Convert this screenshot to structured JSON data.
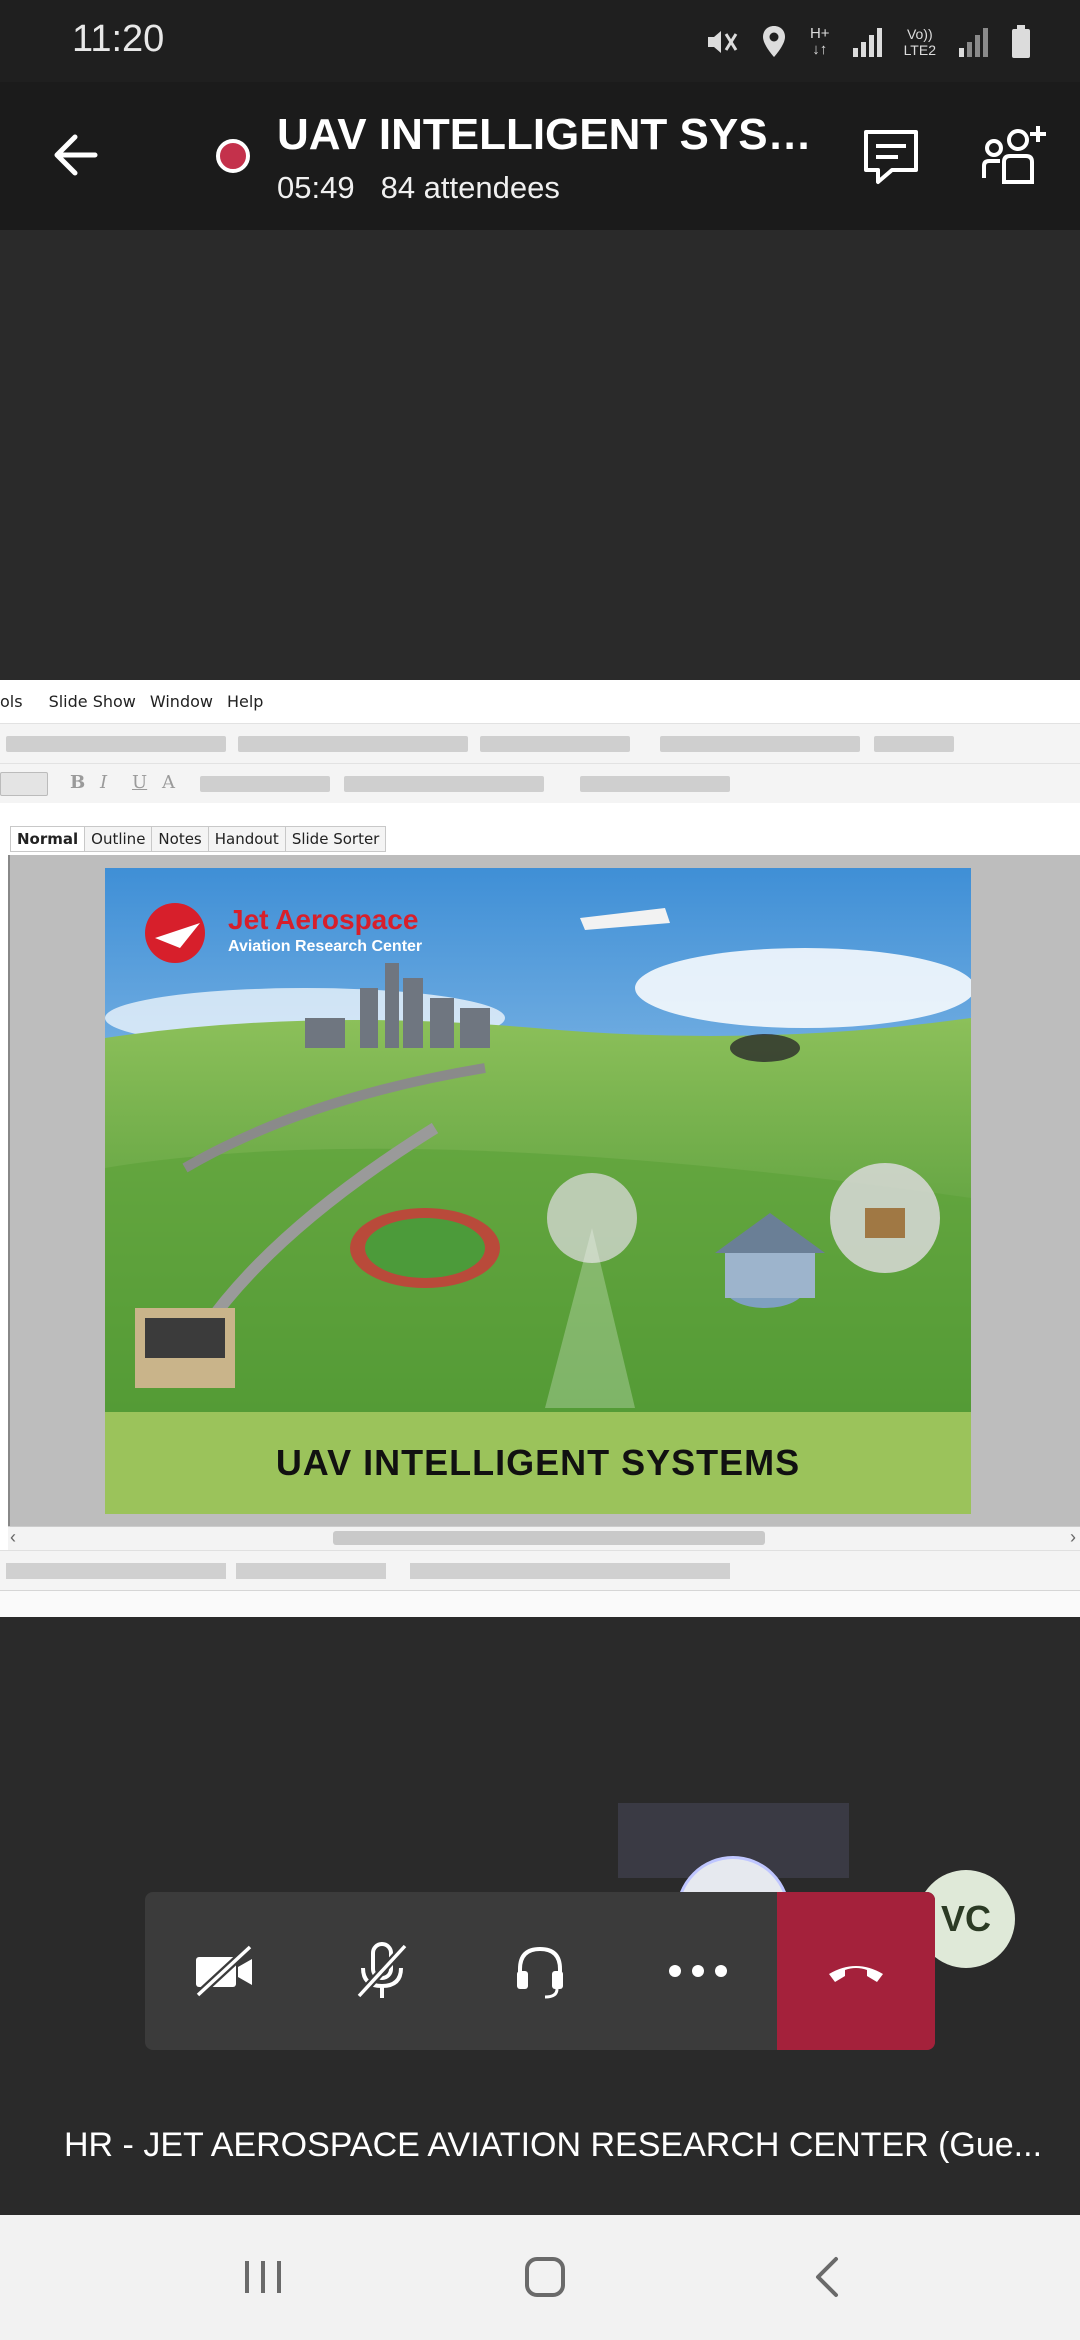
{
  "status_bar": {
    "time": "11:20",
    "icons": [
      "mute-vibrate-icon",
      "location-icon",
      "hplus-data-icon",
      "signal-icon",
      "volte-lte2-icon",
      "signal-icon",
      "battery-icon"
    ],
    "data_label": "H+",
    "volte_label_top": "Vo))",
    "volte_label_bottom": "LTE2"
  },
  "call_header": {
    "title": "UAV INTELLIGENT SYST...",
    "duration": "05:49",
    "attendees": "84 attendees",
    "recording_color": "#c4314b"
  },
  "shared_screen": {
    "menu_items": [
      "ols",
      "Slide Show",
      "Window",
      "Help"
    ],
    "view_tabs": [
      "Normal",
      "Outline",
      "Notes",
      "Handout",
      "Slide Sorter"
    ],
    "active_tab": "Normal",
    "format_glyphs": [
      "B",
      "I",
      "U",
      "A"
    ],
    "slide": {
      "logo_title": "Jet Aerospace",
      "logo_subtitle": "Aviation Research Center",
      "title": "UAV INTELLIGENT SYSTEMS",
      "band_color": "#9bc35b"
    }
  },
  "participants": {
    "vc_initials": "VC",
    "active_speaker_name": "HR - JET AEROSPACE AVIATION RESEARCH CENTER (Gue..."
  },
  "controls": {
    "camera": "camera-off-icon",
    "mic": "mic-off-icon",
    "audio": "headset-icon",
    "more": "more-icon",
    "hangup": "hang-up-icon",
    "hangup_color": "#a4213b"
  },
  "nav_bar": {
    "buttons": [
      "recent-apps-icon",
      "home-icon",
      "back-nav-icon"
    ]
  }
}
